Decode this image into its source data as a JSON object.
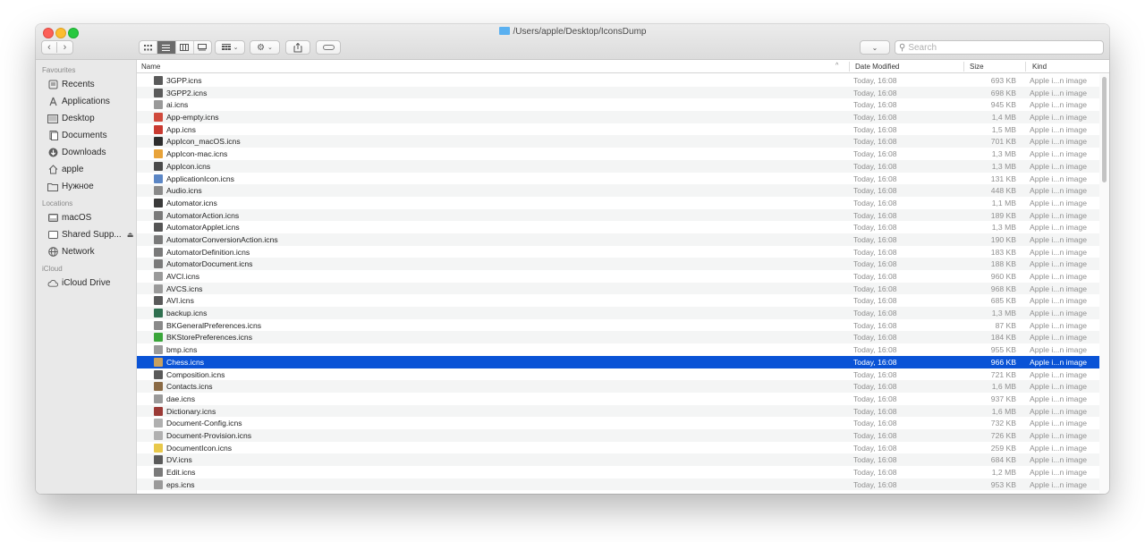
{
  "window": {
    "title": "/Users/apple/Desktop/IconsDump"
  },
  "toolbar": {
    "back": "‹",
    "forward": "›",
    "search_placeholder": "Search"
  },
  "sidebar": {
    "sections": [
      {
        "title": "Favourites",
        "items": [
          {
            "label": "Recents",
            "icon": "recents-icon"
          },
          {
            "label": "Applications",
            "icon": "applications-icon"
          },
          {
            "label": "Desktop",
            "icon": "desktop-icon"
          },
          {
            "label": "Documents",
            "icon": "documents-icon"
          },
          {
            "label": "Downloads",
            "icon": "downloads-icon"
          },
          {
            "label": "apple",
            "icon": "home-icon"
          },
          {
            "label": "Нужное",
            "icon": "folder-icon"
          }
        ]
      },
      {
        "title": "Locations",
        "items": [
          {
            "label": "macOS",
            "icon": "disk-icon"
          },
          {
            "label": "Shared Supp...",
            "icon": "disk-icon"
          },
          {
            "label": "Network",
            "icon": "network-icon"
          }
        ]
      },
      {
        "title": "iCloud",
        "items": [
          {
            "label": "iCloud Drive",
            "icon": "cloud-icon"
          }
        ]
      }
    ]
  },
  "columns": {
    "name": "Name",
    "date": "Date Modified",
    "size": "Size",
    "kind": "Kind"
  },
  "files": [
    {
      "name": "3GPP.icns",
      "date": "Today, 16:08",
      "size": "693 KB",
      "kind": "Apple i...n image",
      "color": "#5a5a5a"
    },
    {
      "name": "3GPP2.icns",
      "date": "Today, 16:08",
      "size": "698 KB",
      "kind": "Apple i...n image",
      "color": "#5a5a5a"
    },
    {
      "name": "ai.icns",
      "date": "Today, 16:08",
      "size": "945 KB",
      "kind": "Apple i...n image",
      "color": "#9a9a9a"
    },
    {
      "name": "App-empty.icns",
      "date": "Today, 16:08",
      "size": "1,4 MB",
      "kind": "Apple i...n image",
      "color": "#d04a3c"
    },
    {
      "name": "App.icns",
      "date": "Today, 16:08",
      "size": "1,5 MB",
      "kind": "Apple i...n image",
      "color": "#c93a31"
    },
    {
      "name": "AppIcon_macOS.icns",
      "date": "Today, 16:08",
      "size": "701 KB",
      "kind": "Apple i...n image",
      "color": "#2d2d2d"
    },
    {
      "name": "AppIcon-mac.icns",
      "date": "Today, 16:08",
      "size": "1,3 MB",
      "kind": "Apple i...n image",
      "color": "#e8a33a"
    },
    {
      "name": "AppIcon.icns",
      "date": "Today, 16:08",
      "size": "1,3 MB",
      "kind": "Apple i...n image",
      "color": "#4a4a4a"
    },
    {
      "name": "ApplicationIcon.icns",
      "date": "Today, 16:08",
      "size": "131 KB",
      "kind": "Apple i...n image",
      "color": "#5b86c5"
    },
    {
      "name": "Audio.icns",
      "date": "Today, 16:08",
      "size": "448 KB",
      "kind": "Apple i...n image",
      "color": "#8a8a8a"
    },
    {
      "name": "Automator.icns",
      "date": "Today, 16:08",
      "size": "1,1 MB",
      "kind": "Apple i...n image",
      "color": "#3a3a3a"
    },
    {
      "name": "AutomatorAction.icns",
      "date": "Today, 16:08",
      "size": "189 KB",
      "kind": "Apple i...n image",
      "color": "#7a7a7a"
    },
    {
      "name": "AutomatorApplet.icns",
      "date": "Today, 16:08",
      "size": "1,3 MB",
      "kind": "Apple i...n image",
      "color": "#555555"
    },
    {
      "name": "AutomatorConversionAction.icns",
      "date": "Today, 16:08",
      "size": "190 KB",
      "kind": "Apple i...n image",
      "color": "#7a7a7a"
    },
    {
      "name": "AutomatorDefinition.icns",
      "date": "Today, 16:08",
      "size": "183 KB",
      "kind": "Apple i...n image",
      "color": "#7a7a7a"
    },
    {
      "name": "AutomatorDocument.icns",
      "date": "Today, 16:08",
      "size": "188 KB",
      "kind": "Apple i...n image",
      "color": "#7a7a7a"
    },
    {
      "name": "AVCI.icns",
      "date": "Today, 16:08",
      "size": "960 KB",
      "kind": "Apple i...n image",
      "color": "#9a9a9a"
    },
    {
      "name": "AVCS.icns",
      "date": "Today, 16:08",
      "size": "968 KB",
      "kind": "Apple i...n image",
      "color": "#9a9a9a"
    },
    {
      "name": "AVI.icns",
      "date": "Today, 16:08",
      "size": "685 KB",
      "kind": "Apple i...n image",
      "color": "#5a5a5a"
    },
    {
      "name": "backup.icns",
      "date": "Today, 16:08",
      "size": "1,3 MB",
      "kind": "Apple i...n image",
      "color": "#2f6f4f"
    },
    {
      "name": "BKGeneralPreferences.icns",
      "date": "Today, 16:08",
      "size": "87 KB",
      "kind": "Apple i...n image",
      "color": "#8a8a8a"
    },
    {
      "name": "BKStorePreferences.icns",
      "date": "Today, 16:08",
      "size": "184 KB",
      "kind": "Apple i...n image",
      "color": "#3aa63a"
    },
    {
      "name": "bmp.icns",
      "date": "Today, 16:08",
      "size": "955 KB",
      "kind": "Apple i...n image",
      "color": "#9a9a9a"
    },
    {
      "name": "Chess.icns",
      "date": "Today, 16:08",
      "size": "966 KB",
      "kind": "Apple i...n image",
      "color": "#c8a060",
      "selected": true
    },
    {
      "name": "Composition.icns",
      "date": "Today, 16:08",
      "size": "721 KB",
      "kind": "Apple i...n image",
      "color": "#5a5a5a"
    },
    {
      "name": "Contacts.icns",
      "date": "Today, 16:08",
      "size": "1,6 MB",
      "kind": "Apple i...n image",
      "color": "#8a6a45"
    },
    {
      "name": "dae.icns",
      "date": "Today, 16:08",
      "size": "937 KB",
      "kind": "Apple i...n image",
      "color": "#9a9a9a"
    },
    {
      "name": "Dictionary.icns",
      "date": "Today, 16:08",
      "size": "1,6 MB",
      "kind": "Apple i...n image",
      "color": "#9b3a36"
    },
    {
      "name": "Document-Config.icns",
      "date": "Today, 16:08",
      "size": "732 KB",
      "kind": "Apple i...n image",
      "color": "#b0b0b0"
    },
    {
      "name": "Document-Provision.icns",
      "date": "Today, 16:08",
      "size": "726 KB",
      "kind": "Apple i...n image",
      "color": "#b0b0b0"
    },
    {
      "name": "DocumentIcon.icns",
      "date": "Today, 16:08",
      "size": "259 KB",
      "kind": "Apple i...n image",
      "color": "#e8c84a"
    },
    {
      "name": "DV.icns",
      "date": "Today, 16:08",
      "size": "684 KB",
      "kind": "Apple i...n image",
      "color": "#5a5a5a"
    },
    {
      "name": "Edit.icns",
      "date": "Today, 16:08",
      "size": "1,2 MB",
      "kind": "Apple i...n image",
      "color": "#7a7a7a"
    },
    {
      "name": "eps.icns",
      "date": "Today, 16:08",
      "size": "953 KB",
      "kind": "Apple i...n image",
      "color": "#9a9a9a"
    }
  ]
}
